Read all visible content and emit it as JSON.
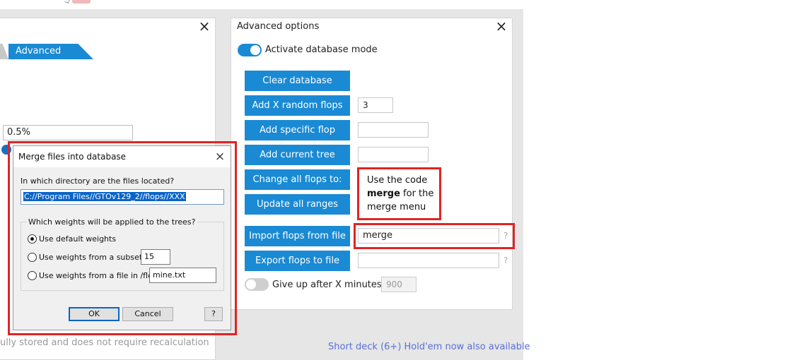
{
  "left_panel": {
    "tab_advanced": "Advanced",
    "percent_value": "0.5%",
    "footer_text": "ully stored and does not require recalculation"
  },
  "right_panel": {
    "title": "Advanced options",
    "db_mode_label": "Activate database mode",
    "db_mode_on": true,
    "buttons": {
      "clear_db": "Clear database",
      "add_random": "Add X random flops",
      "add_specific": "Add specific flop",
      "add_current": "Add current tree",
      "change_all": "Change all flops to:",
      "update_ranges": "Update all ranges",
      "import": "Import flops from file",
      "export": "Export flops to file"
    },
    "random_count": "3",
    "import_value": "merge",
    "help_mark": "?",
    "give_up_label": "Give up after X minutes:",
    "give_up_value": "900",
    "footer_link": "Short deck (6+) Hold'em now also available"
  },
  "annotation": {
    "line1": "Use the code",
    "bold_word": "merge",
    "line2_rest": " for the",
    "line3": "merge menu"
  },
  "dialog": {
    "title": "Merge files into database",
    "question": "In which directory are the files located?",
    "path": "C://Program Files//GTOv129_2//flops//XXX",
    "weights_legend": "Which weights will be applied to the trees?",
    "opt_default": "Use default weights",
    "opt_subset": "Use weights from a subset:",
    "subset_value": "15",
    "opt_file": "Use weights from a file in /flops",
    "file_value": "mine.txt",
    "ok": "OK",
    "cancel": "Cancel",
    "help": "?"
  },
  "colors": {
    "accent": "#1a8ad4",
    "highlight": "#e02424",
    "link": "#5b6fd6"
  }
}
